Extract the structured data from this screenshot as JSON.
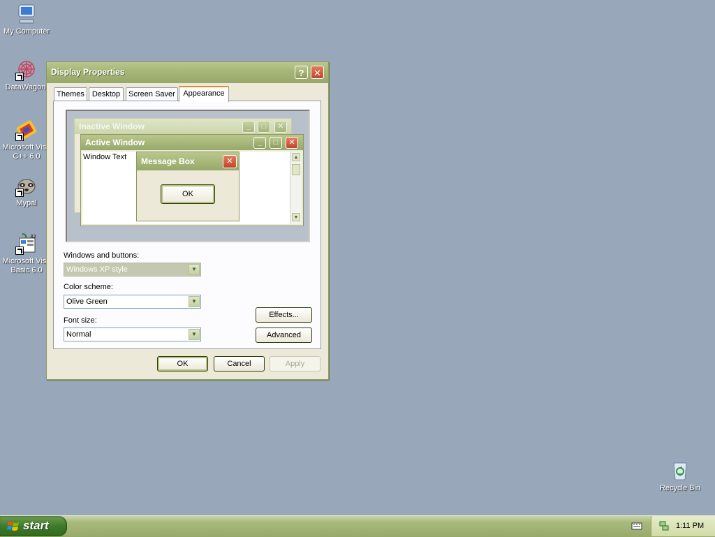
{
  "desktop": {
    "icons": [
      {
        "label": "My Computer"
      },
      {
        "label": "DataWagon."
      },
      {
        "label_line1": "Microsoft Visu",
        "label_line2": "C++ 6.0"
      },
      {
        "label": "Mypal"
      },
      {
        "label_line1": "Microsoft Visu",
        "label_line2": "Basic 6.0"
      },
      {
        "label": "Recycle Bin"
      }
    ]
  },
  "dialog": {
    "title": "Display Properties",
    "help_glyph": "?",
    "close_glyph": "✕",
    "tabs": [
      {
        "label": "Themes"
      },
      {
        "label": "Desktop"
      },
      {
        "label": "Screen Saver"
      },
      {
        "label": "Appearance",
        "active": true
      }
    ],
    "preview": {
      "inactive_title": "Inactive Window",
      "active_title": "Active Window",
      "window_text": "Window Text",
      "message_box_title": "Message Box",
      "message_ok": "OK"
    },
    "windows_buttons": {
      "label": "Windows and buttons:",
      "value": "Windows XP style"
    },
    "color_scheme": {
      "label": "Color scheme:",
      "value": "Olive Green"
    },
    "font_size": {
      "label": "Font size:",
      "value": "Normal"
    },
    "effects_button": "Effects...",
    "advanced_button": "Advanced",
    "ok_button": "OK",
    "cancel_button": "Cancel",
    "apply_button": "Apply"
  },
  "taskbar": {
    "start_label": "start",
    "clock": "1:11 PM"
  },
  "colors": {
    "desktop": "#98a8ba",
    "title_bar": "#a7b77a",
    "close_red": "#c2452a",
    "taskbar": "#a8b97c"
  }
}
